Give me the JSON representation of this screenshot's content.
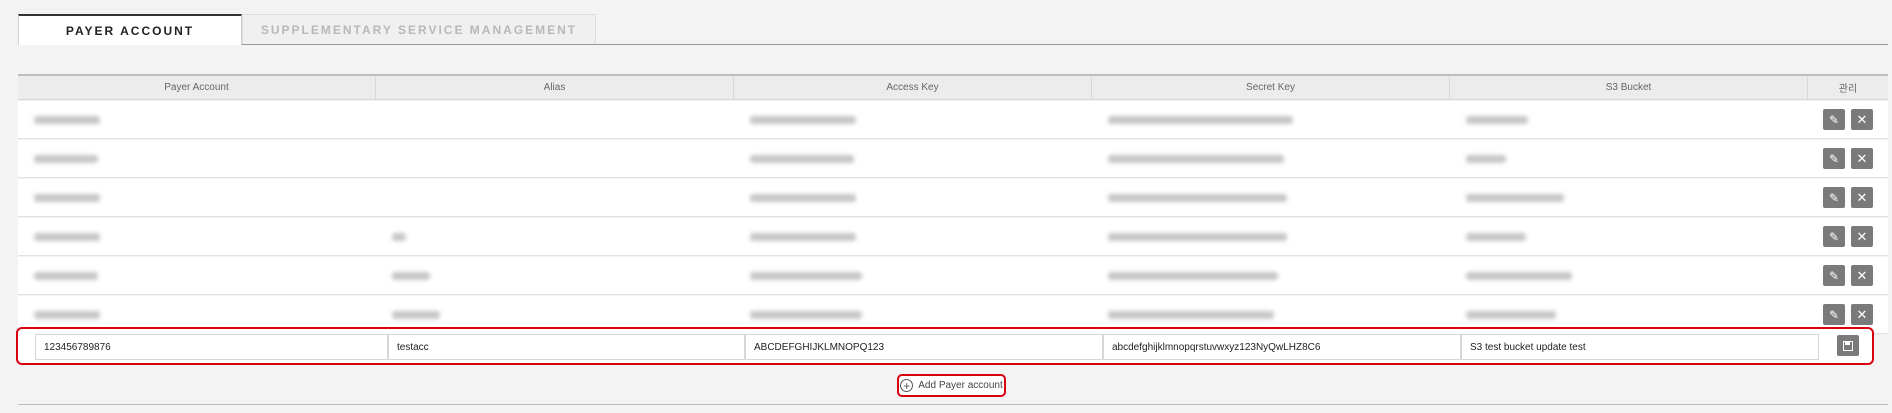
{
  "tabs": [
    {
      "label": "PAYER ACCOUNT",
      "active": true
    },
    {
      "label": "SUPPLEMENTARY SERVICE MANAGEMENT",
      "active": false
    }
  ],
  "table": {
    "headers": [
      "Payer Account",
      "Alias",
      "Access Key",
      "Secret Key",
      "S3 Bucket",
      "관리"
    ],
    "blurred_rows": 6
  },
  "edit_row": {
    "payer_account": "123456789876",
    "alias": "testacc",
    "access_key": "ABCDEFGHIJKLMNOPQ123",
    "secret_key": "abcdefghijklmnopqrstuvwxyz123NyQwLHZ8C6",
    "s3_bucket": "S3 test bucket update test"
  },
  "add_button": {
    "label": "Add Payer account"
  },
  "icons": {
    "edit": "pencil-icon",
    "delete": "close-icon",
    "save": "floppy-icon",
    "add": "plus-circle-icon"
  },
  "colors": {
    "highlight": "#d9000f",
    "button": "#7a7a7a"
  }
}
